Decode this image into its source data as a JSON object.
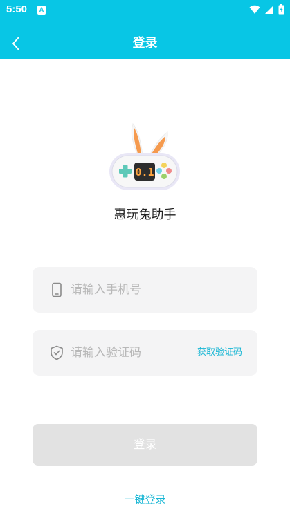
{
  "status_bar": {
    "time": "5:50",
    "notification_badge": "A"
  },
  "header": {
    "title": "登录",
    "back_icon": "chevron-left-icon"
  },
  "app": {
    "name": "惠玩兔助手",
    "logo_screen_text": "0.1"
  },
  "phone": {
    "placeholder": "请输入手机号",
    "value": "",
    "icon": "phone-icon"
  },
  "code": {
    "placeholder": "请输入验证码",
    "value": "",
    "icon": "shield-icon",
    "get_code_label": "获取验证码"
  },
  "login_button": {
    "label": "登录"
  },
  "one_key_login": {
    "label": "一键登录"
  },
  "colors": {
    "primary": "#08c6e5",
    "link": "#17b6d4",
    "field_bg": "#f4f4f5",
    "button_disabled": "#e2e2e2"
  }
}
